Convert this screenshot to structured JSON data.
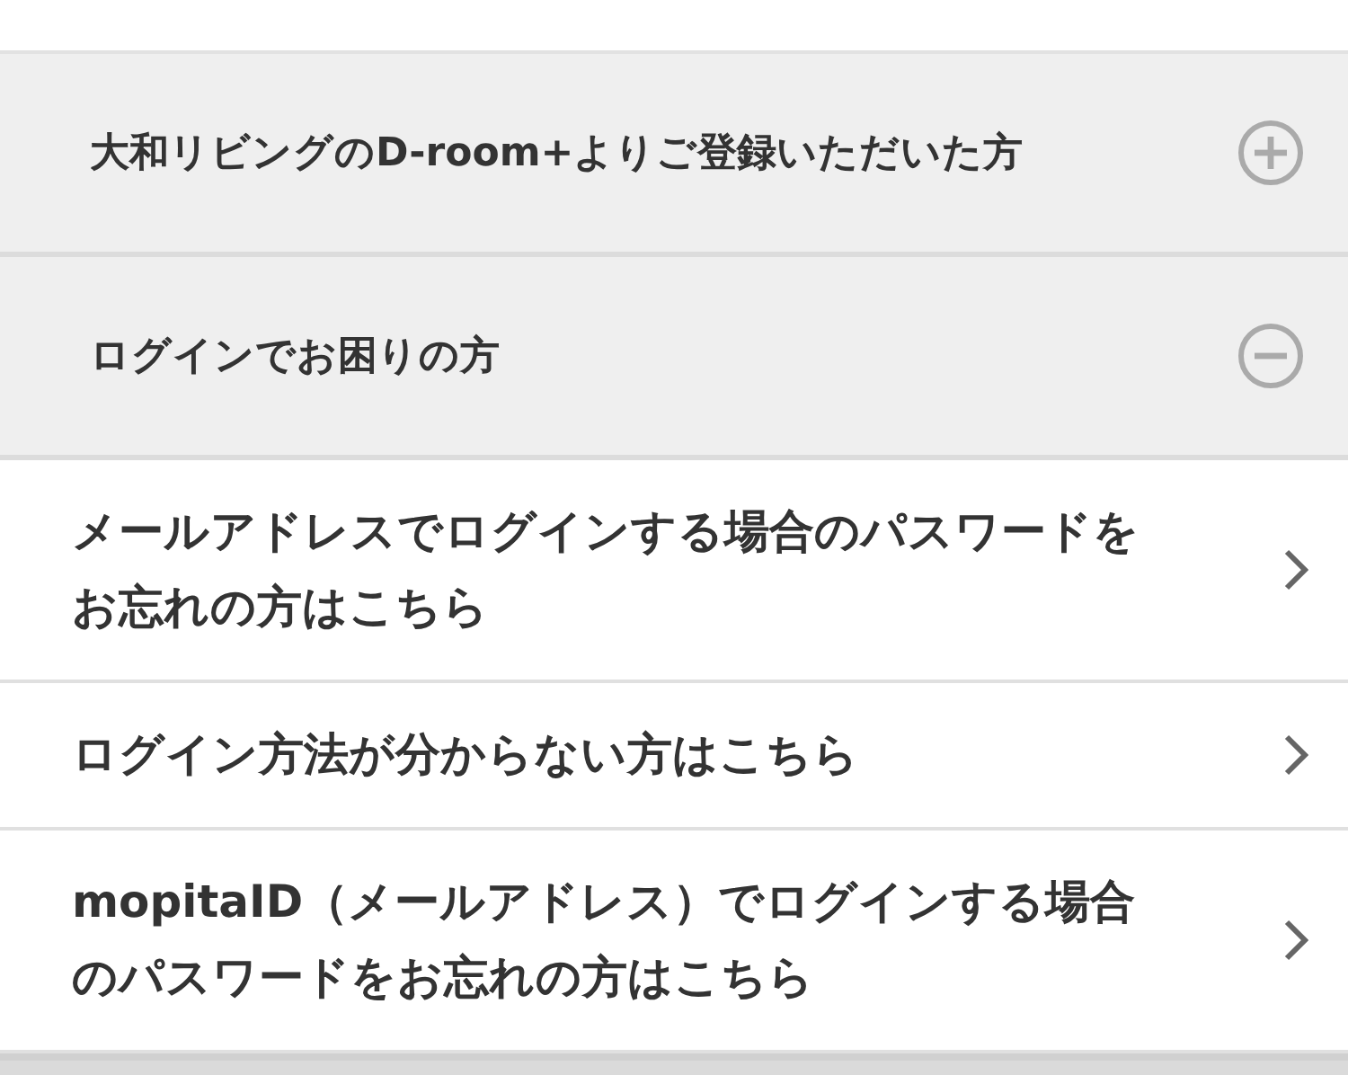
{
  "sections": [
    {
      "title": "大和リビングのD-room+よりご登録いただいた方",
      "expanded": false
    },
    {
      "title": "ログインでお困りの方",
      "expanded": true,
      "links": [
        {
          "lines": [
            "メールアドレスでログインする場合のパスワードを",
            "お忘れの方はこちら"
          ]
        },
        {
          "lines": [
            "ログイン方法が分からない方はこちら"
          ]
        },
        {
          "lines": [
            "mopitaID（メールアドレス）でログインする場合",
            "のパスワードをお忘れの方はこちら"
          ]
        }
      ]
    }
  ]
}
